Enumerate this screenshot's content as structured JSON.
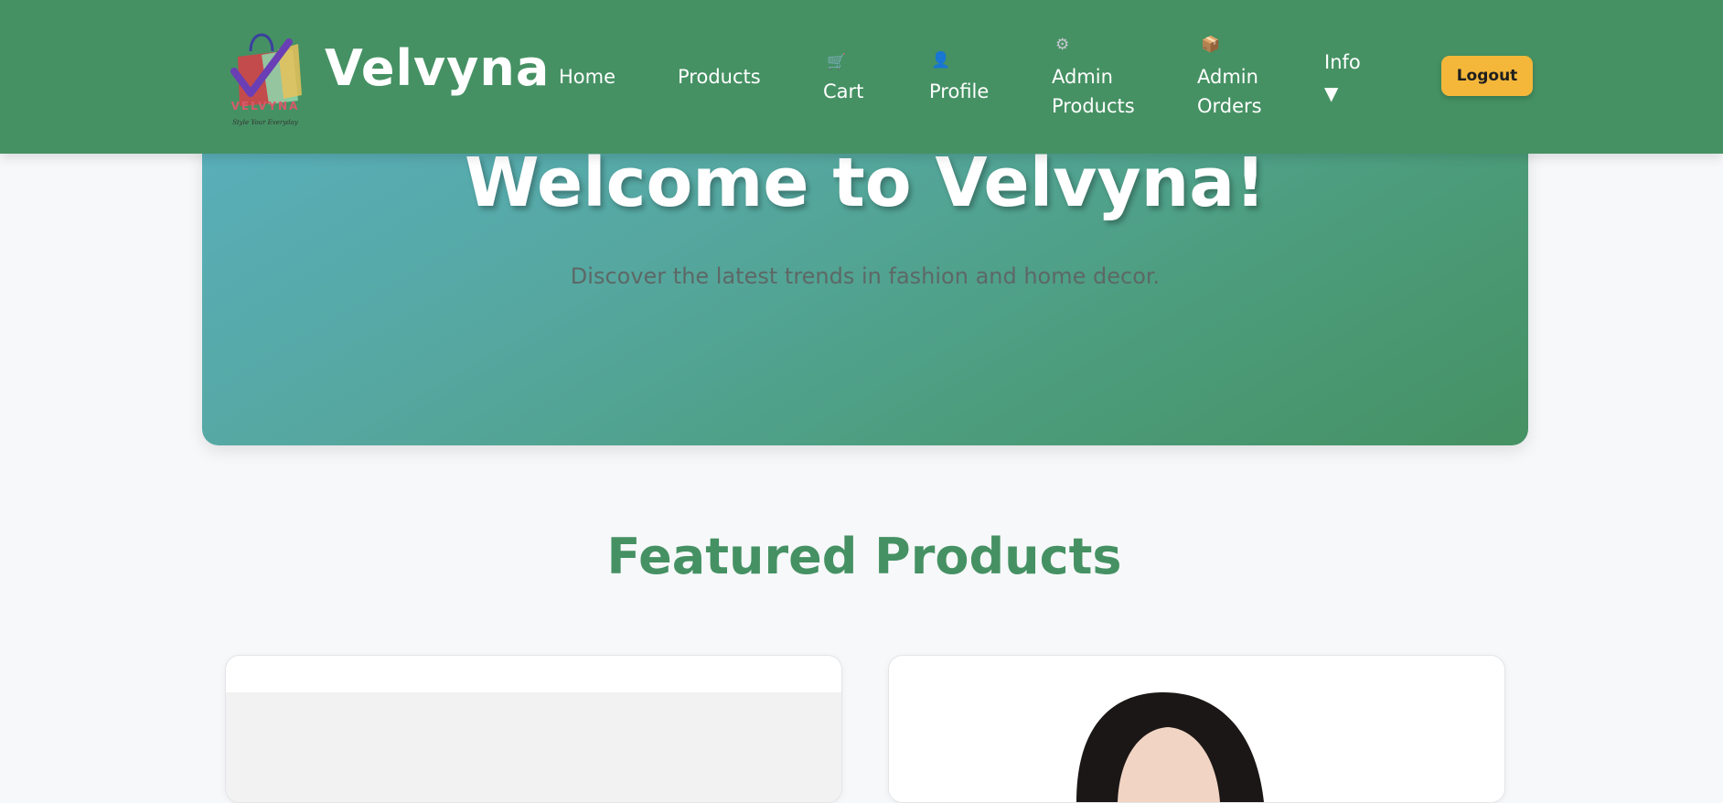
{
  "brand": {
    "name": "Velvyna",
    "logo_text": "VELVYNA",
    "logo_tagline": "Style Your Everyday"
  },
  "nav": {
    "home": "Home",
    "products": "Products",
    "cart": "Cart",
    "profile": "Profile",
    "admin_products_line1": "Admin",
    "admin_products_line2": "Products",
    "admin_orders_line1": "Admin",
    "admin_orders_line2": "Orders",
    "info": "Info",
    "info_caret": "▼",
    "logout": "Logout",
    "icons": {
      "cart": "cart-icon",
      "profile": "user-icon",
      "admin_products": "gear-icon",
      "admin_orders": "package-icon"
    }
  },
  "hero": {
    "title": "Welcome to Velvyna!",
    "subtitle": "Discover the latest trends in fashion and home decor."
  },
  "featured": {
    "title": "Featured Products"
  },
  "colors": {
    "header": "#459163",
    "accent": "#f4b73a",
    "featured_title": "#459163"
  }
}
